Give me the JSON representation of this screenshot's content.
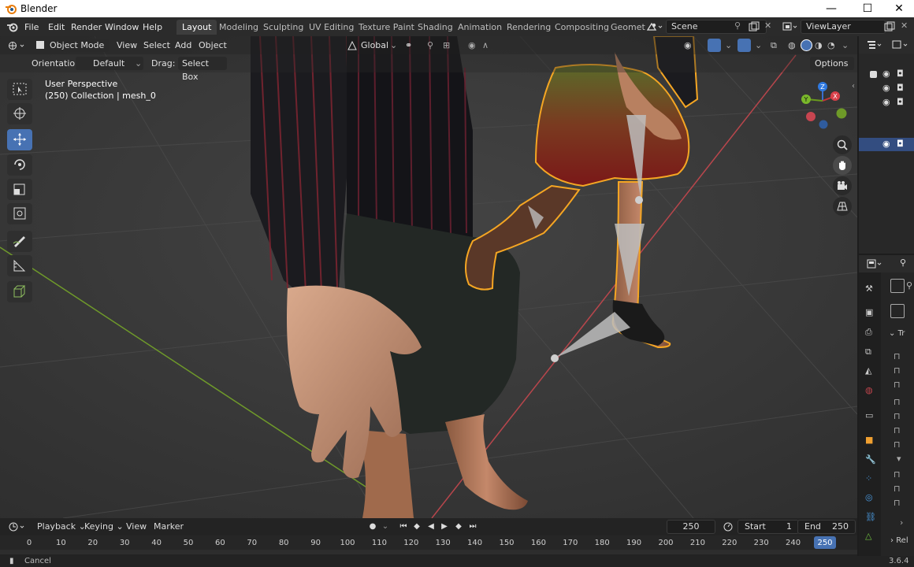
{
  "titlebar": {
    "app_title": "Blender",
    "minimize": "—",
    "maximize": "☐",
    "close": "✕"
  },
  "menus": [
    "File",
    "Edit",
    "Render",
    "Window",
    "Help"
  ],
  "workspace_tabs": [
    "Layout",
    "Modeling",
    "Sculpting",
    "UV Editing",
    "Texture Paint",
    "Shading",
    "Animation",
    "Rendering",
    "Compositing",
    "Geomet"
  ],
  "active_tab": "Layout",
  "scene": {
    "value": "Scene"
  },
  "view_layer": {
    "value": "ViewLayer"
  },
  "viewport_header": {
    "mode": "Object Mode",
    "view": "View",
    "select": "Select",
    "add": "Add",
    "object": "Object",
    "transform_space": "Global",
    "orientation_label": "Orientation:",
    "orientation_value": "Default",
    "drag_label": "Drag:",
    "drag_value": "Select Box",
    "options": "Options"
  },
  "viewport_info": {
    "perspective": "User Perspective",
    "collection": "(250) Collection | mesh_0"
  },
  "gizmo": {
    "x": "X",
    "y": "Y",
    "z": "Z"
  },
  "timeline": {
    "playback": "Playback",
    "keying": "Keying",
    "view": "View",
    "marker": "Marker",
    "current_frame": "250",
    "start_label": "Start",
    "start_value": "1",
    "end_label": "End",
    "end_value": "250",
    "ticks": [
      "0",
      "10",
      "20",
      "30",
      "40",
      "50",
      "60",
      "70",
      "80",
      "90",
      "100",
      "110",
      "120",
      "130",
      "140",
      "150",
      "160",
      "170",
      "180",
      "190",
      "200",
      "210",
      "220",
      "230",
      "240",
      "250"
    ]
  },
  "status": {
    "left": "Cancel",
    "version": "3.6.4"
  },
  "properties": {
    "tab_partial": "Tr",
    "rel_partial": "Rel"
  },
  "colors": {
    "accent": "#4772b3",
    "selection_outline": "#f5a623",
    "x_axis": "#c4373b",
    "y_axis": "#6a9a1e",
    "z_axis": "#2b6fd1"
  }
}
